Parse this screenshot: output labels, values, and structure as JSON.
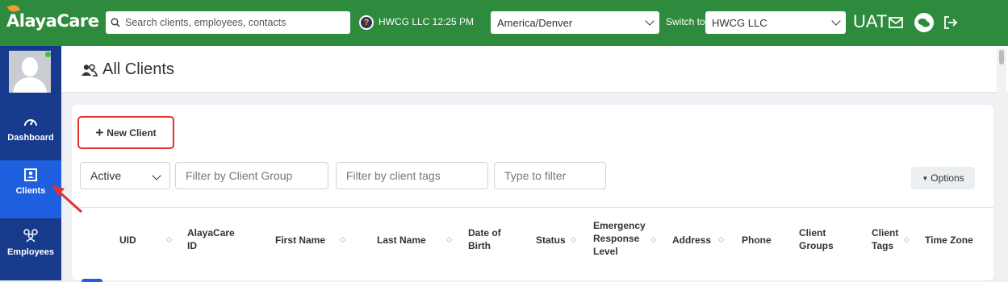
{
  "topbar": {
    "logo": "AlayaCare",
    "search_placeholder": "Search clients, employees, contacts",
    "company_time": "HWCG LLC 12:25 PM",
    "timezone_value": "America/Denver",
    "switch_label": "Switch to",
    "switch_value": "HWCG LLC",
    "env_label": "UAT",
    "icons": [
      "help-icon",
      "mail-icon",
      "chat-icon",
      "logout-icon"
    ]
  },
  "sidebar": {
    "items": [
      {
        "label": "Dashboard",
        "icon": "dashboard-icon"
      },
      {
        "label": "Clients",
        "icon": "clients-icon",
        "active": true
      },
      {
        "label": "Employees",
        "icon": "employees-icon"
      }
    ]
  },
  "page": {
    "title": "All Clients",
    "new_client_label": "New Client",
    "filters": {
      "status_value": "Active",
      "client_group_placeholder": "Filter by Client Group",
      "client_tags_placeholder": "Filter by client tags",
      "text_placeholder": "Type to filter"
    },
    "options_label": "Options"
  },
  "table": {
    "columns": [
      {
        "line1": "UID",
        "line2": "",
        "line3": ""
      },
      {
        "line1": "AlayaCare",
        "line2": "ID",
        "line3": ""
      },
      {
        "line1": "First Name",
        "line2": "",
        "line3": ""
      },
      {
        "line1": "Last Name",
        "line2": "",
        "line3": ""
      },
      {
        "line1": "Date of",
        "line2": "Birth",
        "line3": ""
      },
      {
        "line1": "Status",
        "line2": "",
        "line3": ""
      },
      {
        "line1": "Emergency",
        "line2": "Response",
        "line3": "Level"
      },
      {
        "line1": "Address",
        "line2": "",
        "line3": ""
      },
      {
        "line1": "Phone",
        "line2": "",
        "line3": ""
      },
      {
        "line1": "Client",
        "line2": "Groups",
        "line3": ""
      },
      {
        "line1": "Client",
        "line2": "Tags",
        "line3": ""
      },
      {
        "line1": "Time Zone",
        "line2": "",
        "line3": ""
      }
    ]
  },
  "colors": {
    "topbar": "#2e8b3d",
    "sidebar": "#173a8c",
    "active_nav": "#1e5fe0",
    "highlight": "#e03030"
  }
}
